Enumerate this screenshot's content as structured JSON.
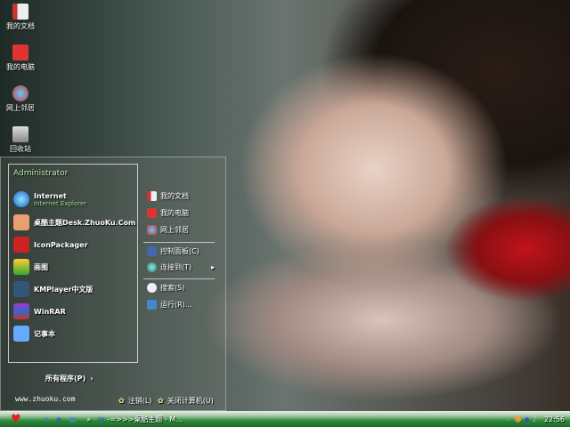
{
  "desktop_icons": [
    {
      "label": "我的文档"
    },
    {
      "label": "我的电脑"
    },
    {
      "label": "网上邻居"
    },
    {
      "label": "回收站"
    }
  ],
  "start_menu": {
    "user": "Administrator",
    "left_items": [
      {
        "label": "Internet",
        "sub": "Internet Explorer"
      },
      {
        "label": "桌酷主题Desk.ZhuoKu.Com"
      },
      {
        "label": "IconPackager"
      },
      {
        "label": "画图"
      },
      {
        "label": "KMPlayer中文版"
      },
      {
        "label": "WinRAR"
      },
      {
        "label": "记事本"
      }
    ],
    "all_programs": "所有程序(P)",
    "right_items": [
      {
        "label": "我的文档"
      },
      {
        "label": "我的电脑"
      },
      {
        "label": "网上邻居"
      },
      {
        "label": "控制面板(C)"
      },
      {
        "label": "连接到(T)"
      },
      {
        "label": "搜索(S)"
      },
      {
        "label": "运行(R)..."
      }
    ],
    "footer_url": "www.zhuoku.com",
    "logoff": "注销(L)",
    "shutdown": "关闭计算机(U)"
  },
  "taskbar": {
    "task": "-=>>>桌酷主题 - M...",
    "clock": "22:56",
    "chevron": "»"
  }
}
